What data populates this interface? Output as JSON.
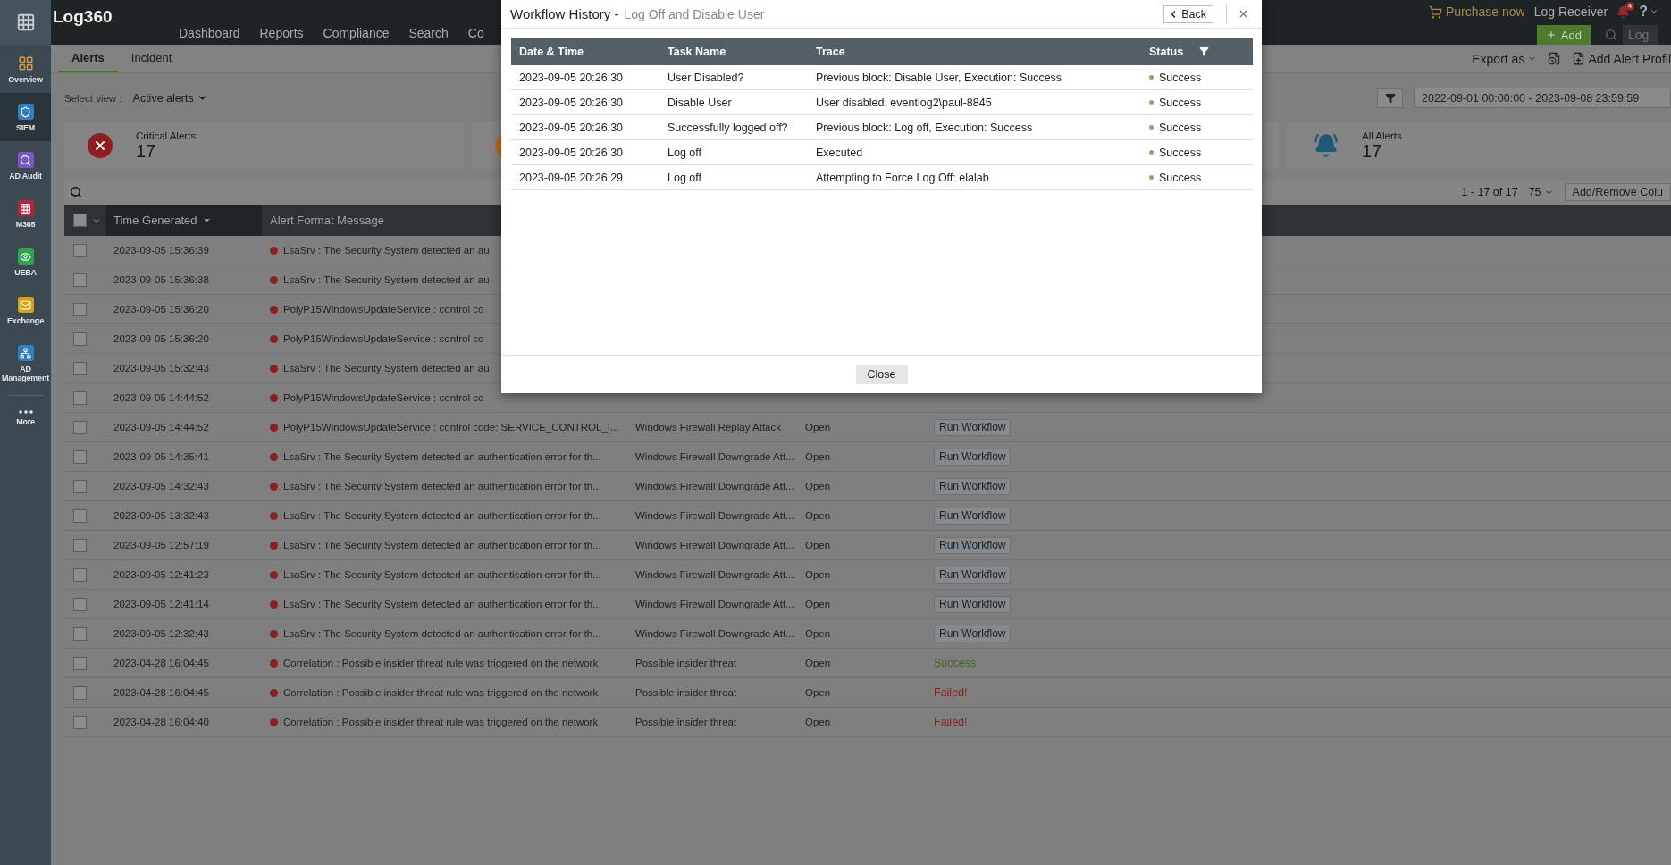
{
  "sidebar": {
    "items": [
      {
        "label": "Overview",
        "selected": false
      },
      {
        "label": "SIEM",
        "selected": true
      },
      {
        "label": "AD Audit",
        "selected": false
      },
      {
        "label": "M365",
        "selected": false
      },
      {
        "label": "UEBA",
        "selected": false
      },
      {
        "label": "Exchange",
        "selected": false
      },
      {
        "label": "AD Management",
        "selected": false
      },
      {
        "label": "More",
        "selected": false
      }
    ]
  },
  "topbar": {
    "logo": "Log360",
    "nav": [
      "Dashboard",
      "Reports",
      "Compliance",
      "Search",
      "Co"
    ],
    "purchase": "Purchase now",
    "log_receiver": "Log Receiver",
    "notifications": "4",
    "help": "?",
    "add": "Add",
    "search": {
      "placeholder": "Log"
    }
  },
  "tabs": [
    {
      "label": "Alerts",
      "selected": true
    },
    {
      "label": "Incident",
      "selected": false
    }
  ],
  "toolbar": {
    "export": "Export as",
    "add_profile": "Add Alert Profil"
  },
  "view": {
    "label": "Select view :",
    "value": "Active alerts"
  },
  "date_range": "2022-09-01 00:00:00 - 2023-09-08 23:59:59",
  "cards": [
    {
      "kind": "critical",
      "label": "Critical Alerts",
      "count": "17"
    },
    {
      "kind": "trouble"
    },
    {
      "kind": "plain"
    },
    {
      "kind": "all",
      "label": "All Alerts",
      "count": "17"
    }
  ],
  "pagination": {
    "range": "1 - 17 of 17",
    "per_page": "75",
    "columns_button": "Add/Remove Colu"
  },
  "table": {
    "select_all_checked": false,
    "columns": [
      "Time Generated",
      "Alert Format Message"
    ],
    "rows": [
      {
        "checked": false,
        "time": "2023-09-05 15:36:39",
        "message": "LsaSrv : The Security System detected an au"
      },
      {
        "checked": false,
        "time": "2023-09-05 15:36:38",
        "message": "LsaSrv : The Security System detected an au"
      },
      {
        "checked": false,
        "time": "2023-09-05 15:36:20",
        "message": "PolyP15WindowsUpdateService : control co"
      },
      {
        "checked": false,
        "time": "2023-09-05 15:36:20",
        "message": "PolyP15WindowsUpdateService : control co"
      },
      {
        "checked": false,
        "time": "2023-09-05 15:32:43",
        "message": "LsaSrv : The Security System detected an au"
      },
      {
        "checked": false,
        "time": "2023-09-05 14:44:52",
        "message": "PolyP15WindowsUpdateService : control co"
      },
      {
        "checked": false,
        "time": "2023-09-05 14:44:52",
        "message": "PolyP15WindowsUpdateService : control code: SERVICE_CONTROL_I...",
        "alert": "Windows Firewall Replay Attack",
        "status": "Open",
        "action": {
          "kind": "button",
          "label": "Run Workflow"
        }
      },
      {
        "checked": false,
        "time": "2023-09-05 14:35:41",
        "message": "LsaSrv : The Security System detected an authentication error for th...",
        "alert": "Windows Firewall Downgrade Att...",
        "status": "Open",
        "action": {
          "kind": "button",
          "label": "Run Workflow"
        }
      },
      {
        "checked": false,
        "time": "2023-09-05 14:32:43",
        "message": "LsaSrv : The Security System detected an authentication error for th...",
        "alert": "Windows Firewall Downgrade Att...",
        "status": "Open",
        "action": {
          "kind": "button",
          "label": "Run Workflow"
        }
      },
      {
        "checked": false,
        "time": "2023-09-05 13:32:43",
        "message": "LsaSrv : The Security System detected an authentication error for th...",
        "alert": "Windows Firewall Downgrade Att...",
        "status": "Open",
        "action": {
          "kind": "button",
          "label": "Run Workflow"
        }
      },
      {
        "checked": false,
        "time": "2023-09-05 12:57:19",
        "message": "LsaSrv : The Security System detected an authentication error for th...",
        "alert": "Windows Firewall Downgrade Att...",
        "status": "Open",
        "action": {
          "kind": "button",
          "label": "Run Workflow"
        }
      },
      {
        "checked": false,
        "time": "2023-09-05 12:41:23",
        "message": "LsaSrv : The Security System detected an authentication error for th...",
        "alert": "Windows Firewall Downgrade Att...",
        "status": "Open",
        "action": {
          "kind": "button",
          "label": "Run Workflow"
        }
      },
      {
        "checked": false,
        "time": "2023-09-05 12:41:14",
        "message": "LsaSrv : The Security System detected an authentication error for th...",
        "alert": "Windows Firewall Downgrade Att...",
        "status": "Open",
        "action": {
          "kind": "button",
          "label": "Run Workflow"
        }
      },
      {
        "checked": false,
        "time": "2023-09-05 12:32:43",
        "message": "LsaSrv : The Security System detected an authentication error for th...",
        "alert": "Windows Firewall Downgrade Att...",
        "status": "Open",
        "action": {
          "kind": "button",
          "label": "Run Workflow"
        }
      },
      {
        "checked": false,
        "time": "2023-04-28 16:04:45",
        "message": "Correlation : Possible insider threat rule was triggered on the network",
        "alert": "Possible insider threat",
        "status": "Open",
        "action": {
          "kind": "success",
          "label": "Success"
        }
      },
      {
        "checked": false,
        "time": "2023-04-28 16:04:45",
        "message": "Correlation : Possible insider threat rule was triggered on the network",
        "alert": "Possible insider threat",
        "status": "Open",
        "action": {
          "kind": "failed",
          "label": "Failed!"
        }
      },
      {
        "checked": false,
        "time": "2023-04-28 16:04:40",
        "message": "Correlation : Possible insider threat rule was triggered on the network",
        "alert": "Possible insider threat",
        "status": "Open",
        "action": {
          "kind": "failed",
          "label": "Failed!"
        }
      }
    ]
  },
  "modal": {
    "title": "Workflow History -",
    "subtitle": "Log Off and Disable User",
    "back": "Back",
    "columns": [
      "Date & Time",
      "Task Name",
      "Trace",
      "Status"
    ],
    "rows": [
      {
        "time": "2023-09-05 20:26:30",
        "task": "User Disabled?",
        "trace": "Previous block: Disable User, Execution: Success",
        "status": "Success"
      },
      {
        "time": "2023-09-05 20:26:30",
        "task": "Disable User",
        "trace": "User disabled: eventlog2\\paul-8845",
        "status": "Success"
      },
      {
        "time": "2023-09-05 20:26:30",
        "task": "Successfully logged off?",
        "trace": "Previous block: Log off, Execution: Success",
        "status": "Success"
      },
      {
        "time": "2023-09-05 20:26:30",
        "task": "Log off",
        "trace": "Executed",
        "status": "Success"
      },
      {
        "time": "2023-09-05 20:26:29",
        "task": "Log off",
        "trace": "Attempting to Force Log Off: elalab",
        "status": "Success"
      }
    ],
    "close": "Close"
  }
}
